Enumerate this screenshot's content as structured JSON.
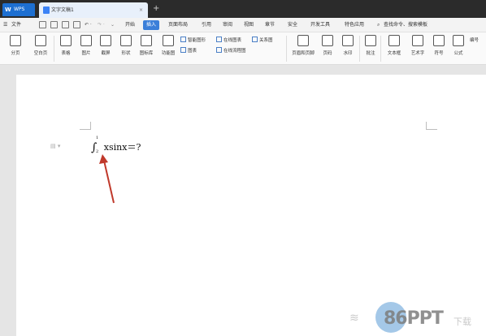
{
  "titlebar": {
    "app_tab": "WPS",
    "doc_tab": "文字文稿1",
    "close": "×",
    "new_tab": "+"
  },
  "menubar": {
    "file": "文件",
    "tabs": [
      "开始",
      "插入",
      "页面布局",
      "引用",
      "审阅",
      "视图",
      "章节",
      "安全",
      "开发工具",
      "特色应用"
    ],
    "active_tab": "插入",
    "search": "查找命令、搜索模板"
  },
  "ribbon": {
    "buttons": [
      "分页",
      "空白页",
      "表格",
      "图片",
      "截屏",
      "形状",
      "图标库",
      "功能图",
      "页眉和页脚",
      "页码",
      "水印",
      "批注",
      "文本框",
      "艺术字",
      "符号",
      "公式"
    ],
    "small": [
      "智能图形",
      "在线图表",
      "关系图",
      "图表",
      "在线流程图",
      "流程图"
    ],
    "cut_label": "编号"
  },
  "document": {
    "integral_upper": "1",
    "integral_lower": "2",
    "formula_body": "xsinx＝?"
  },
  "watermark": {
    "brand": "86PPT",
    "suffix": "下载"
  },
  "colors": {
    "titlebar": "#2b2b2b",
    "accent": "#3b7fd9",
    "arrow": "#c0392b"
  }
}
